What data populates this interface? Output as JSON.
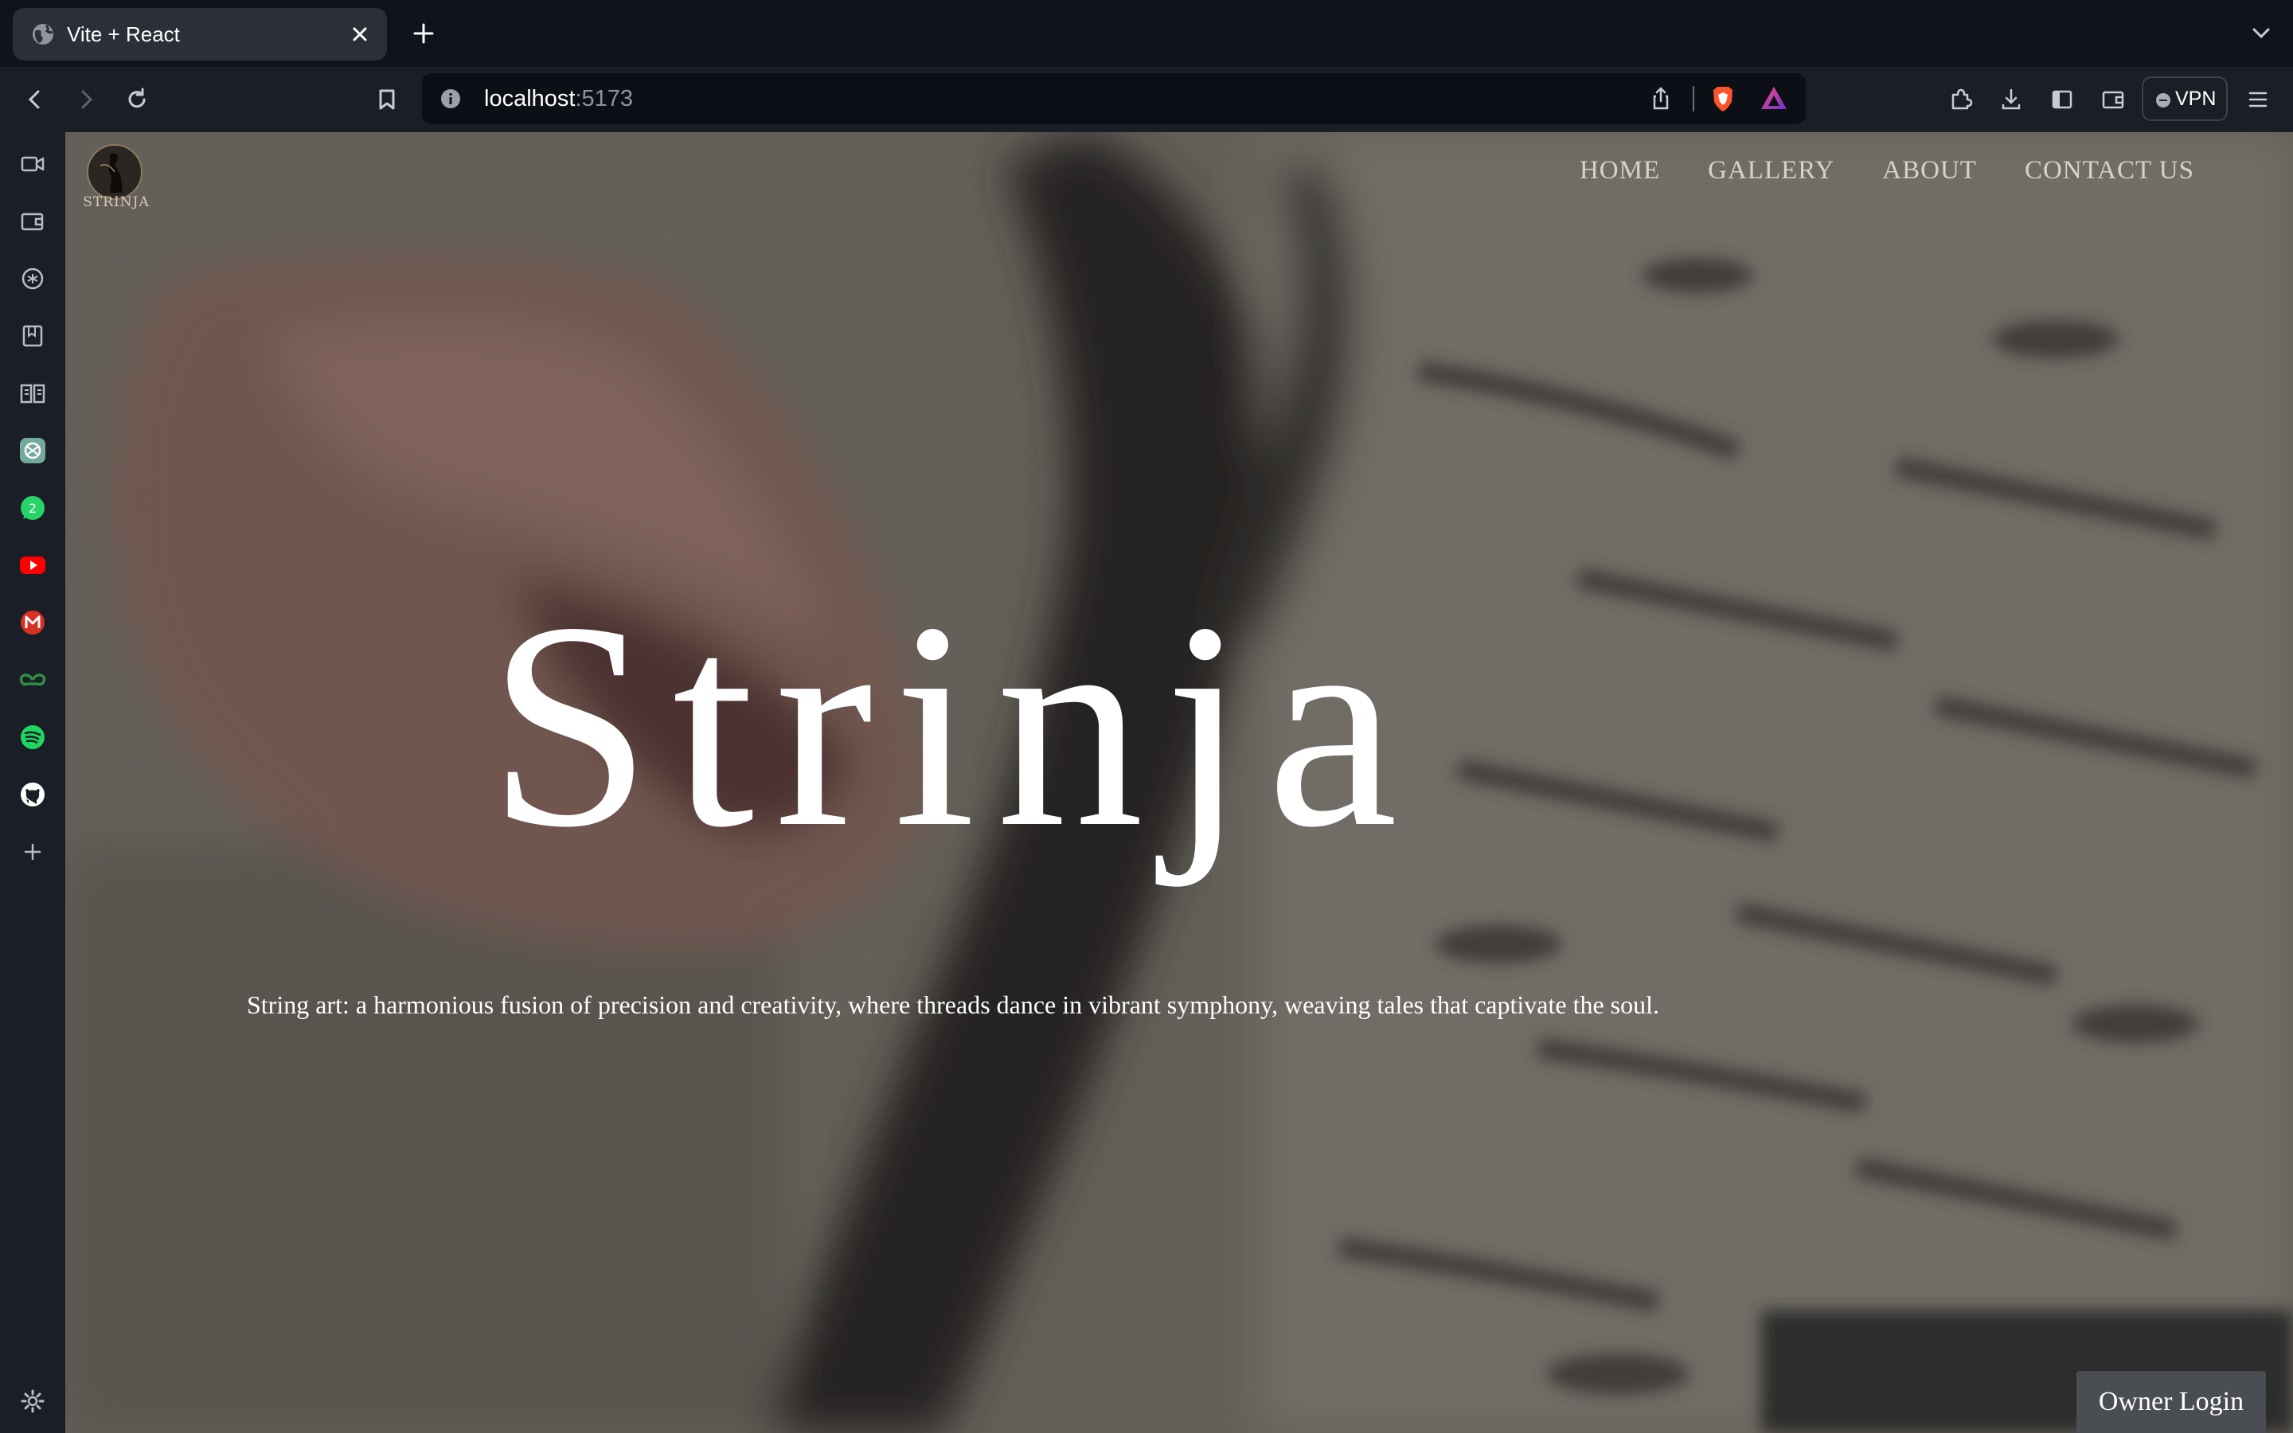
{
  "browser": {
    "tab": {
      "title": "Vite + React"
    },
    "address_bar": {
      "host": "localhost",
      "port": ":5173"
    },
    "vpn_label": "VPN",
    "toolbar_icons": [
      "back-icon",
      "forward-icon",
      "reload-icon",
      "bookmark-icon",
      "info-icon",
      "share-icon",
      "brave-shield-icon",
      "brave-rewards-icon",
      "extensions-icon",
      "downloads-icon",
      "sidebar-toggle-icon",
      "wallet-icon",
      "vpn-icon",
      "menu-icon"
    ],
    "sidebar_icons": [
      "leo-video-icon",
      "wallet-icon",
      "brave-talk-icon",
      "bookmarks-icon",
      "reading-list-icon",
      "chatgpt-icon",
      "whatsapp-icon",
      "youtube-icon",
      "gmail-icon",
      "geeksforgeeks-icon",
      "spotify-icon",
      "github-icon",
      "add-icon",
      "settings-icon"
    ],
    "whatsapp_badge": "2"
  },
  "page": {
    "logo_text": "STRINJA",
    "nav": [
      "HOME",
      "GALLERY",
      "ABOUT",
      "CONTACT US"
    ],
    "hero": {
      "title": "Strinja",
      "tagline": "String art: a harmonious fusion of precision and creativity, where threads dance in vibrant symphony, weaving tales that captivate the soul."
    },
    "owner_login": "Owner Login"
  }
}
